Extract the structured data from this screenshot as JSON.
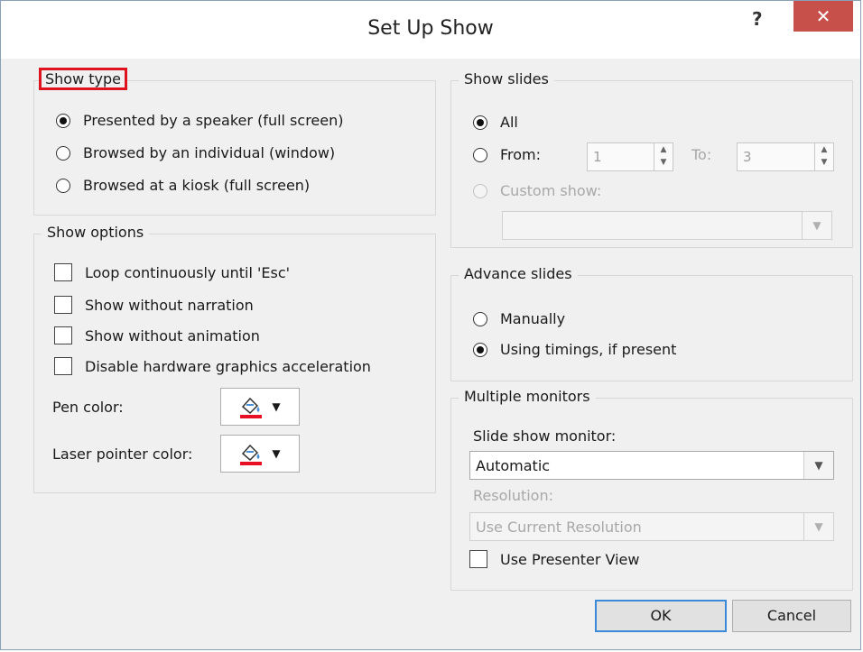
{
  "window": {
    "title": "Set Up Show",
    "help_label": "?",
    "close_label": "✕"
  },
  "show_type": {
    "legend": "Show type",
    "options": [
      {
        "label": "Presented by a speaker (full screen)",
        "selected": true
      },
      {
        "label": "Browsed by an individual (window)",
        "selected": false
      },
      {
        "label": "Browsed at a kiosk (full screen)",
        "selected": false
      }
    ]
  },
  "show_options": {
    "legend": "Show options",
    "checkboxes": [
      {
        "label": "Loop continuously until 'Esc'",
        "checked": false
      },
      {
        "label": "Show without narration",
        "checked": false
      },
      {
        "label": "Show without animation",
        "checked": false
      },
      {
        "label": "Disable hardware graphics acceleration",
        "checked": false
      }
    ],
    "pen_color_label": "Pen color:",
    "laser_color_label": "Laser pointer color:",
    "pen_color": "#e81123",
    "laser_color": "#e81123"
  },
  "show_slides": {
    "legend": "Show slides",
    "all_label": "All",
    "from_label": "From:",
    "from_value": "1",
    "to_label": "To:",
    "to_value": "3",
    "custom_label": "Custom show:",
    "custom_value": ""
  },
  "advance_slides": {
    "legend": "Advance slides",
    "manually_label": "Manually",
    "timings_label": "Using timings, if present"
  },
  "monitors": {
    "legend": "Multiple monitors",
    "monitor_label": "Slide show monitor:",
    "monitor_value": "Automatic",
    "resolution_label": "Resolution:",
    "resolution_value": "Use Current Resolution",
    "presenter_view_label": "Use Presenter View"
  },
  "buttons": {
    "ok": "OK",
    "cancel": "Cancel"
  }
}
